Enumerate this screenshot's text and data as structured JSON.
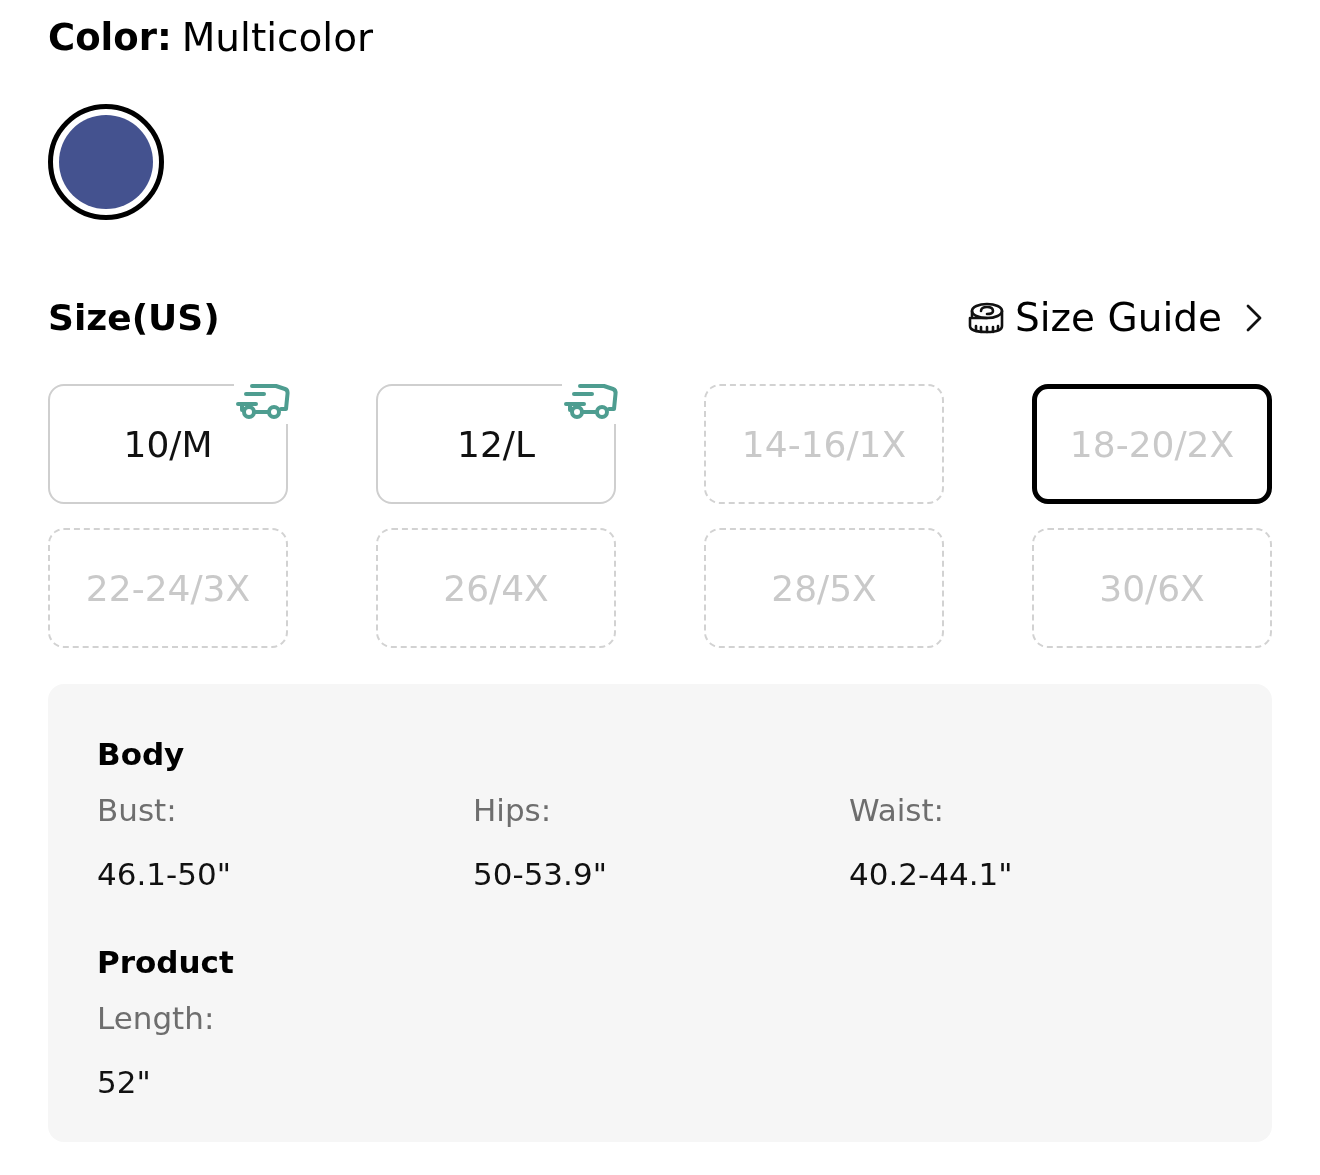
{
  "color": {
    "label": "Color:",
    "value": "Multicolor",
    "swatches": [
      {
        "selected": true,
        "color": "#44528f"
      }
    ]
  },
  "size": {
    "title": "Size(US)",
    "guide_link": "Size Guide",
    "options": [
      {
        "label": "10/M",
        "available": true,
        "selected": false,
        "shipping_badge": true
      },
      {
        "label": "12/L",
        "available": true,
        "selected": false,
        "shipping_badge": true
      },
      {
        "label": "14-16/1X",
        "available": false,
        "selected": false,
        "shipping_badge": false
      },
      {
        "label": "18-20/2X",
        "available": false,
        "selected": true,
        "shipping_badge": false
      },
      {
        "label": "22-24/3X",
        "available": false,
        "selected": false,
        "shipping_badge": false
      },
      {
        "label": "26/4X",
        "available": false,
        "selected": false,
        "shipping_badge": false
      },
      {
        "label": "28/5X",
        "available": false,
        "selected": false,
        "shipping_badge": false
      },
      {
        "label": "30/6X",
        "available": false,
        "selected": false,
        "shipping_badge": false
      }
    ]
  },
  "measurements": {
    "sections": [
      {
        "title": "Body",
        "fields": [
          {
            "label": "Bust:",
            "value": "46.1-50\""
          },
          {
            "label": "Hips:",
            "value": "50-53.9\""
          },
          {
            "label": "Waist:",
            "value": "40.2-44.1\""
          }
        ]
      },
      {
        "title": "Product",
        "fields": [
          {
            "label": "Length:",
            "value": "52\""
          }
        ]
      }
    ]
  }
}
